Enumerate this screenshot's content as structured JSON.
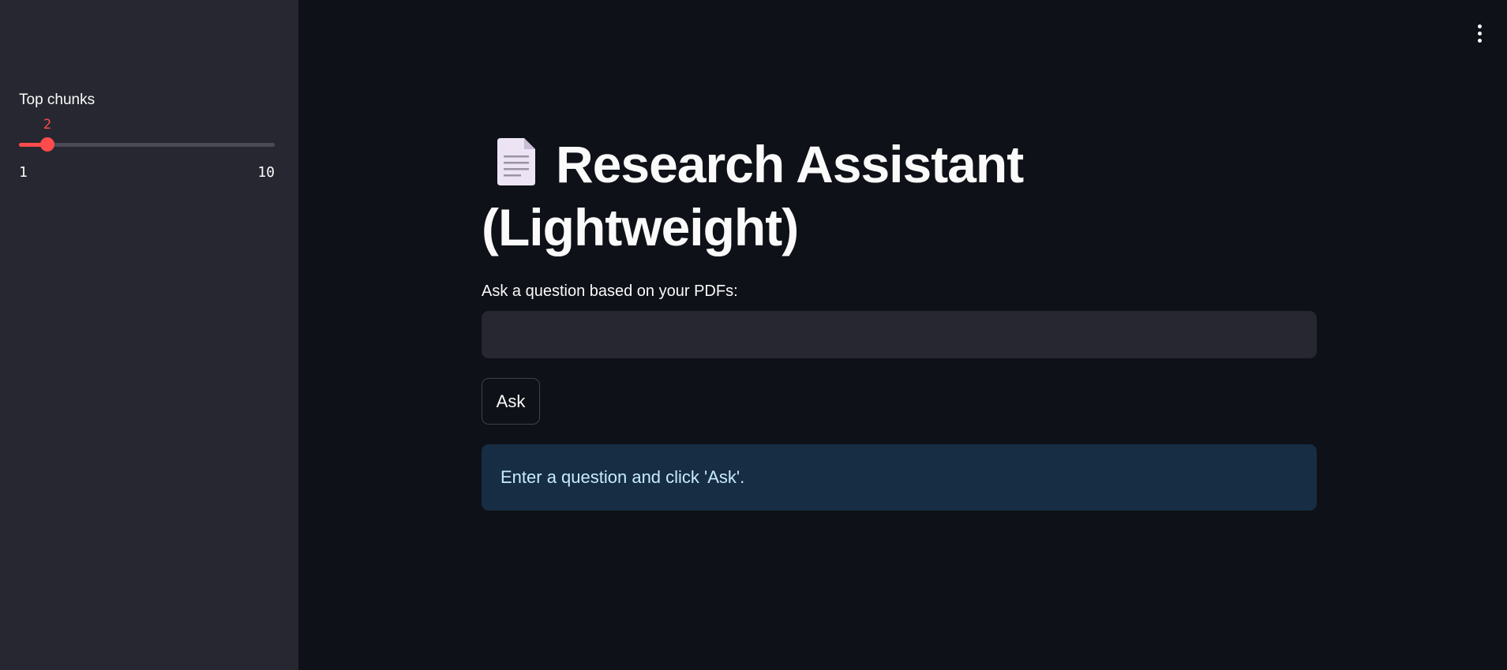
{
  "sidebar": {
    "slider": {
      "label": "Top chunks",
      "value": 2,
      "min": 1,
      "max": 10,
      "min_label": "1",
      "max_label": "10",
      "value_label": "2",
      "accent_color": "#ff4b4b"
    }
  },
  "header": {
    "menu_icon": "kebab-menu-icon"
  },
  "main": {
    "title": "Research Assistant (Lightweight)",
    "title_icon": "page-facing-up-icon",
    "question": {
      "label": "Ask a question based on your PDFs:",
      "value": "",
      "placeholder": ""
    },
    "ask_button_label": "Ask",
    "info_message": "Enter a question and click 'Ask'."
  },
  "colors": {
    "background": "#0e1117",
    "sidebar": "#262730",
    "info_background": "#172d43",
    "info_text": "#c7ebff"
  }
}
